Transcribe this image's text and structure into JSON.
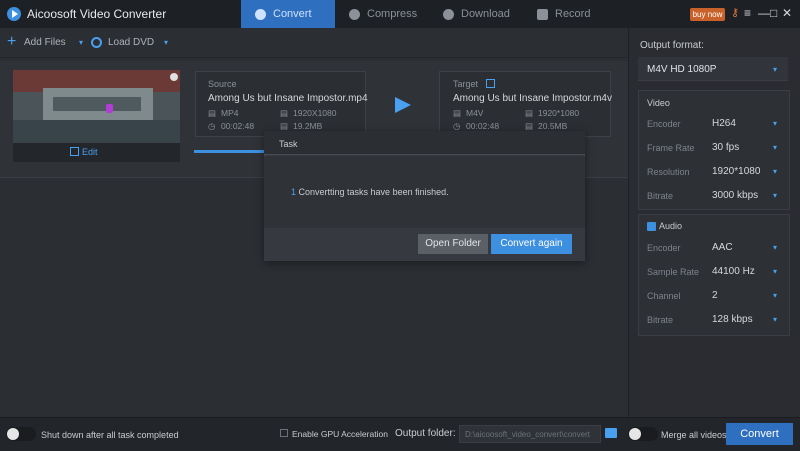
{
  "app": {
    "title": "Aicoosoft Video Converter"
  },
  "tabs": [
    {
      "label": "Convert",
      "icon": "convert-icon",
      "active": true
    },
    {
      "label": "Compress",
      "icon": "compress-icon"
    },
    {
      "label": "Download",
      "icon": "download-icon"
    },
    {
      "label": "Record",
      "icon": "record-icon"
    }
  ],
  "window": {
    "buy_now": "buy now",
    "key_icon": "key-icon",
    "menu_icon": "menu-icon",
    "minimize": "—",
    "maximize": "□",
    "close": "✕"
  },
  "toolbar": {
    "add_files": "Add Files",
    "load_dvd": "Load DVD",
    "dropdown_caret": "▾"
  },
  "video": {
    "edit_label": "Edit",
    "source": {
      "title": "Source",
      "filename": "Among Us but Insane Impostor.mp4",
      "format": "MP4",
      "resolution": "1920X1080",
      "duration": "00:02:48",
      "size": "19.2MB"
    },
    "target": {
      "title": "Target",
      "filename": "Among Us but Insane Impostor.m4v",
      "format": "M4V",
      "resolution": "1920*1080",
      "duration": "00:02:48",
      "size": "20.5MB"
    }
  },
  "dialog": {
    "title": "Task",
    "count": "1",
    "message": " Convertting tasks have been finished.",
    "open_folder": "Open Folder",
    "convert_again": "Convert again"
  },
  "output": {
    "label": "Output format:",
    "format": "M4V HD 1080P",
    "video_section": "Video",
    "video": [
      {
        "name": "Encoder",
        "value": "H264"
      },
      {
        "name": "Frame Rate",
        "value": "30 fps"
      },
      {
        "name": "Resolution",
        "value": "1920*1080"
      },
      {
        "name": "Bitrate",
        "value": "3000 kbps"
      }
    ],
    "audio_section": "Audio",
    "audio": [
      {
        "name": "Encoder",
        "value": "AAC"
      },
      {
        "name": "Sample Rate",
        "value": "44100 Hz"
      },
      {
        "name": "Channel",
        "value": "2"
      },
      {
        "name": "Bitrate",
        "value": "128 kbps"
      }
    ]
  },
  "bottom": {
    "shutdown": "Shut down after all task completed",
    "gpu": "Enable GPU Acceleration",
    "output_folder_label": "Output folder:",
    "output_folder_path": "D:\\aicoosoft_video_convert\\convert",
    "merge": "Merge all videos",
    "convert": "Convert"
  },
  "colors": {
    "accent": "#3d8fe0",
    "active_tab": "#2f6fbf",
    "buy_now": "#c9622a"
  }
}
